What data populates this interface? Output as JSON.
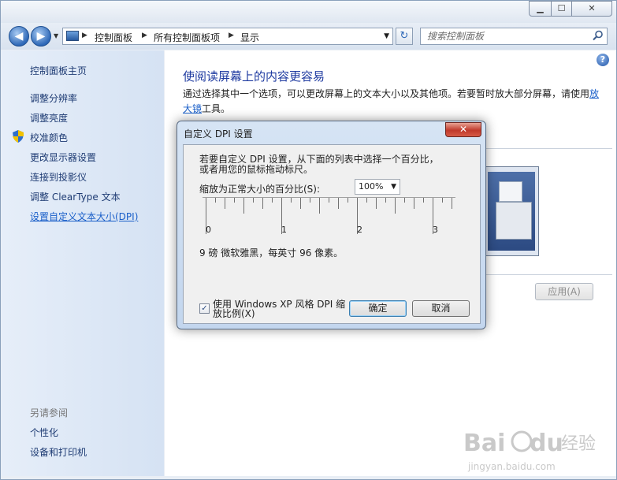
{
  "window": {
    "minimize_glyph": "▁",
    "maximize_glyph": "☐",
    "close_glyph": "✕"
  },
  "nav": {
    "back_glyph": "◀",
    "forward_glyph": "▶",
    "breadcrumbs": [
      "控制面板",
      "所有控制面板项",
      "显示"
    ],
    "separator": "▶",
    "search_placeholder": "搜索控制面板",
    "refresh_glyph": "↻"
  },
  "sidebar": {
    "home": "控制面板主页",
    "items": [
      "调整分辨率",
      "调整亮度",
      "校准颜色",
      "更改显示器设置",
      "连接到投影仪",
      "调整 ClearType 文本",
      "设置自定义文本大小(DPI)"
    ],
    "active_index": 6,
    "see_also_title": "另请参阅",
    "see_also": [
      "个性化",
      "设备和打印机"
    ]
  },
  "main": {
    "help_glyph": "?",
    "title": "使阅读屏幕上的内容更容易",
    "desc_before": "通过选择其中一个选项，可以更改屏幕上的文本大小以及其他项。若要暂时放大部分屏幕，请使用",
    "desc_link": "放大镜",
    "desc_after": "工具。",
    "apply_label": "应用(A)"
  },
  "dialog": {
    "title": "自定义 DPI 设置",
    "close_glyph": "✕",
    "instruction_line1": "若要自定义 DPI 设置，从下面的列表中选择一个百分比，",
    "instruction_line2": "或者用您的鼠标拖动标尺。",
    "scale_label": "缩放为正常大小的百分比(S):",
    "scale_value": "100%",
    "ruler_numbers": [
      "0",
      "1",
      "2",
      "3"
    ],
    "font_info": "9 磅 微软雅黑，每英寸 96 像素。",
    "xp_checkbox_checked": true,
    "xp_checkbox_label": "使用 Windows XP 风格 DPI 缩放比例(X)",
    "ok_label": "确定",
    "cancel_label": "取消"
  },
  "watermark": {
    "brand": "Bai",
    "brand2": "du",
    "suffix": "经验",
    "url": "jingyan.baidu.com"
  }
}
